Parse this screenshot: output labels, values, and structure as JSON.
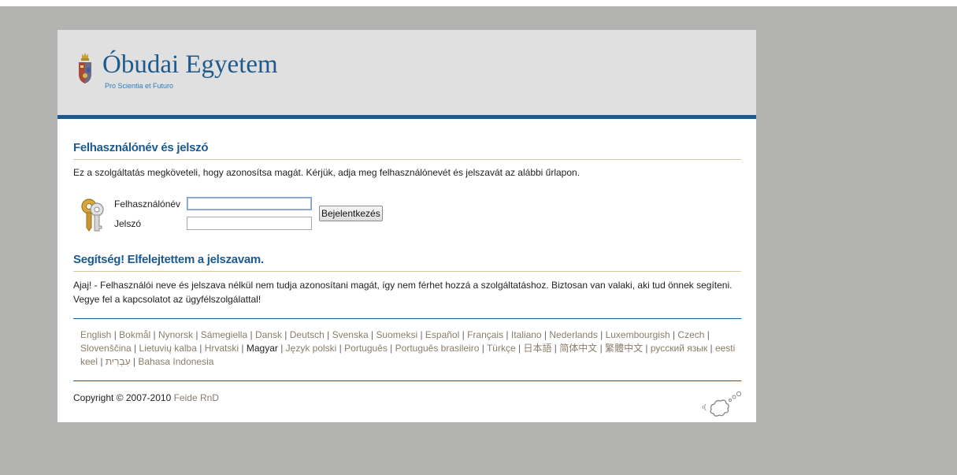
{
  "header": {
    "title": "Óbudai Egyetem",
    "subtitle": "Pro Scientia et Futuro"
  },
  "login": {
    "heading": "Felhasználónév és jelszó",
    "intro": "Ez a szolgáltatás megköveteli, hogy azonosítsa magát. Kérjük, adja meg felhasználónevét és jelszavát az alábbi űrlapon.",
    "username_label": "Felhasználónév",
    "username_value": "",
    "password_label": "Jelszó",
    "password_value": "",
    "submit_label": "Bejelentkezés"
  },
  "help": {
    "heading": "Segítség! Elfelejtettem a jelszavam.",
    "text": "Ajaj! - Felhasználói neve és jelszava nélkül nem tudja azonosítani magát, így nem férhet hozzá a szolgáltatáshoz. Biztosan van valaki, aki tud önnek segíteni. Vegye fel a kapcsolatot az ügyfélszolgálattal!"
  },
  "languages": {
    "separator": " | ",
    "current": "Magyar",
    "items": [
      "English",
      "Bokmål",
      "Nynorsk",
      "Sámegiella",
      "Dansk",
      "Deutsch",
      "Svenska",
      "Suomeksi",
      "Español",
      "Français",
      "Italiano",
      "Nederlands",
      "Luxembourgish",
      "Czech",
      "Slovenščina",
      "Lietuvių kalba",
      "Hrvatski",
      "Magyar",
      "Język polski",
      "Português",
      "Português brasileiro",
      "Türkçe",
      "日本語",
      "简体中文",
      "繁體中文",
      "русский язык",
      "eesti keel",
      "עִבְרִית",
      "Bahasa Indonesia"
    ]
  },
  "footer": {
    "copyright": "Copyright © 2007-2010 ",
    "link": "Feide RnD"
  },
  "icons": {
    "crest": "university-crest-icon",
    "keys": "keys-icon",
    "feide": "feide-logo-icon"
  },
  "colors": {
    "brand_blue": "#1d5a8e",
    "header_bg": "#e0e0e0",
    "link": "#8a7d6b",
    "page_bg": "#b3b3b1"
  }
}
